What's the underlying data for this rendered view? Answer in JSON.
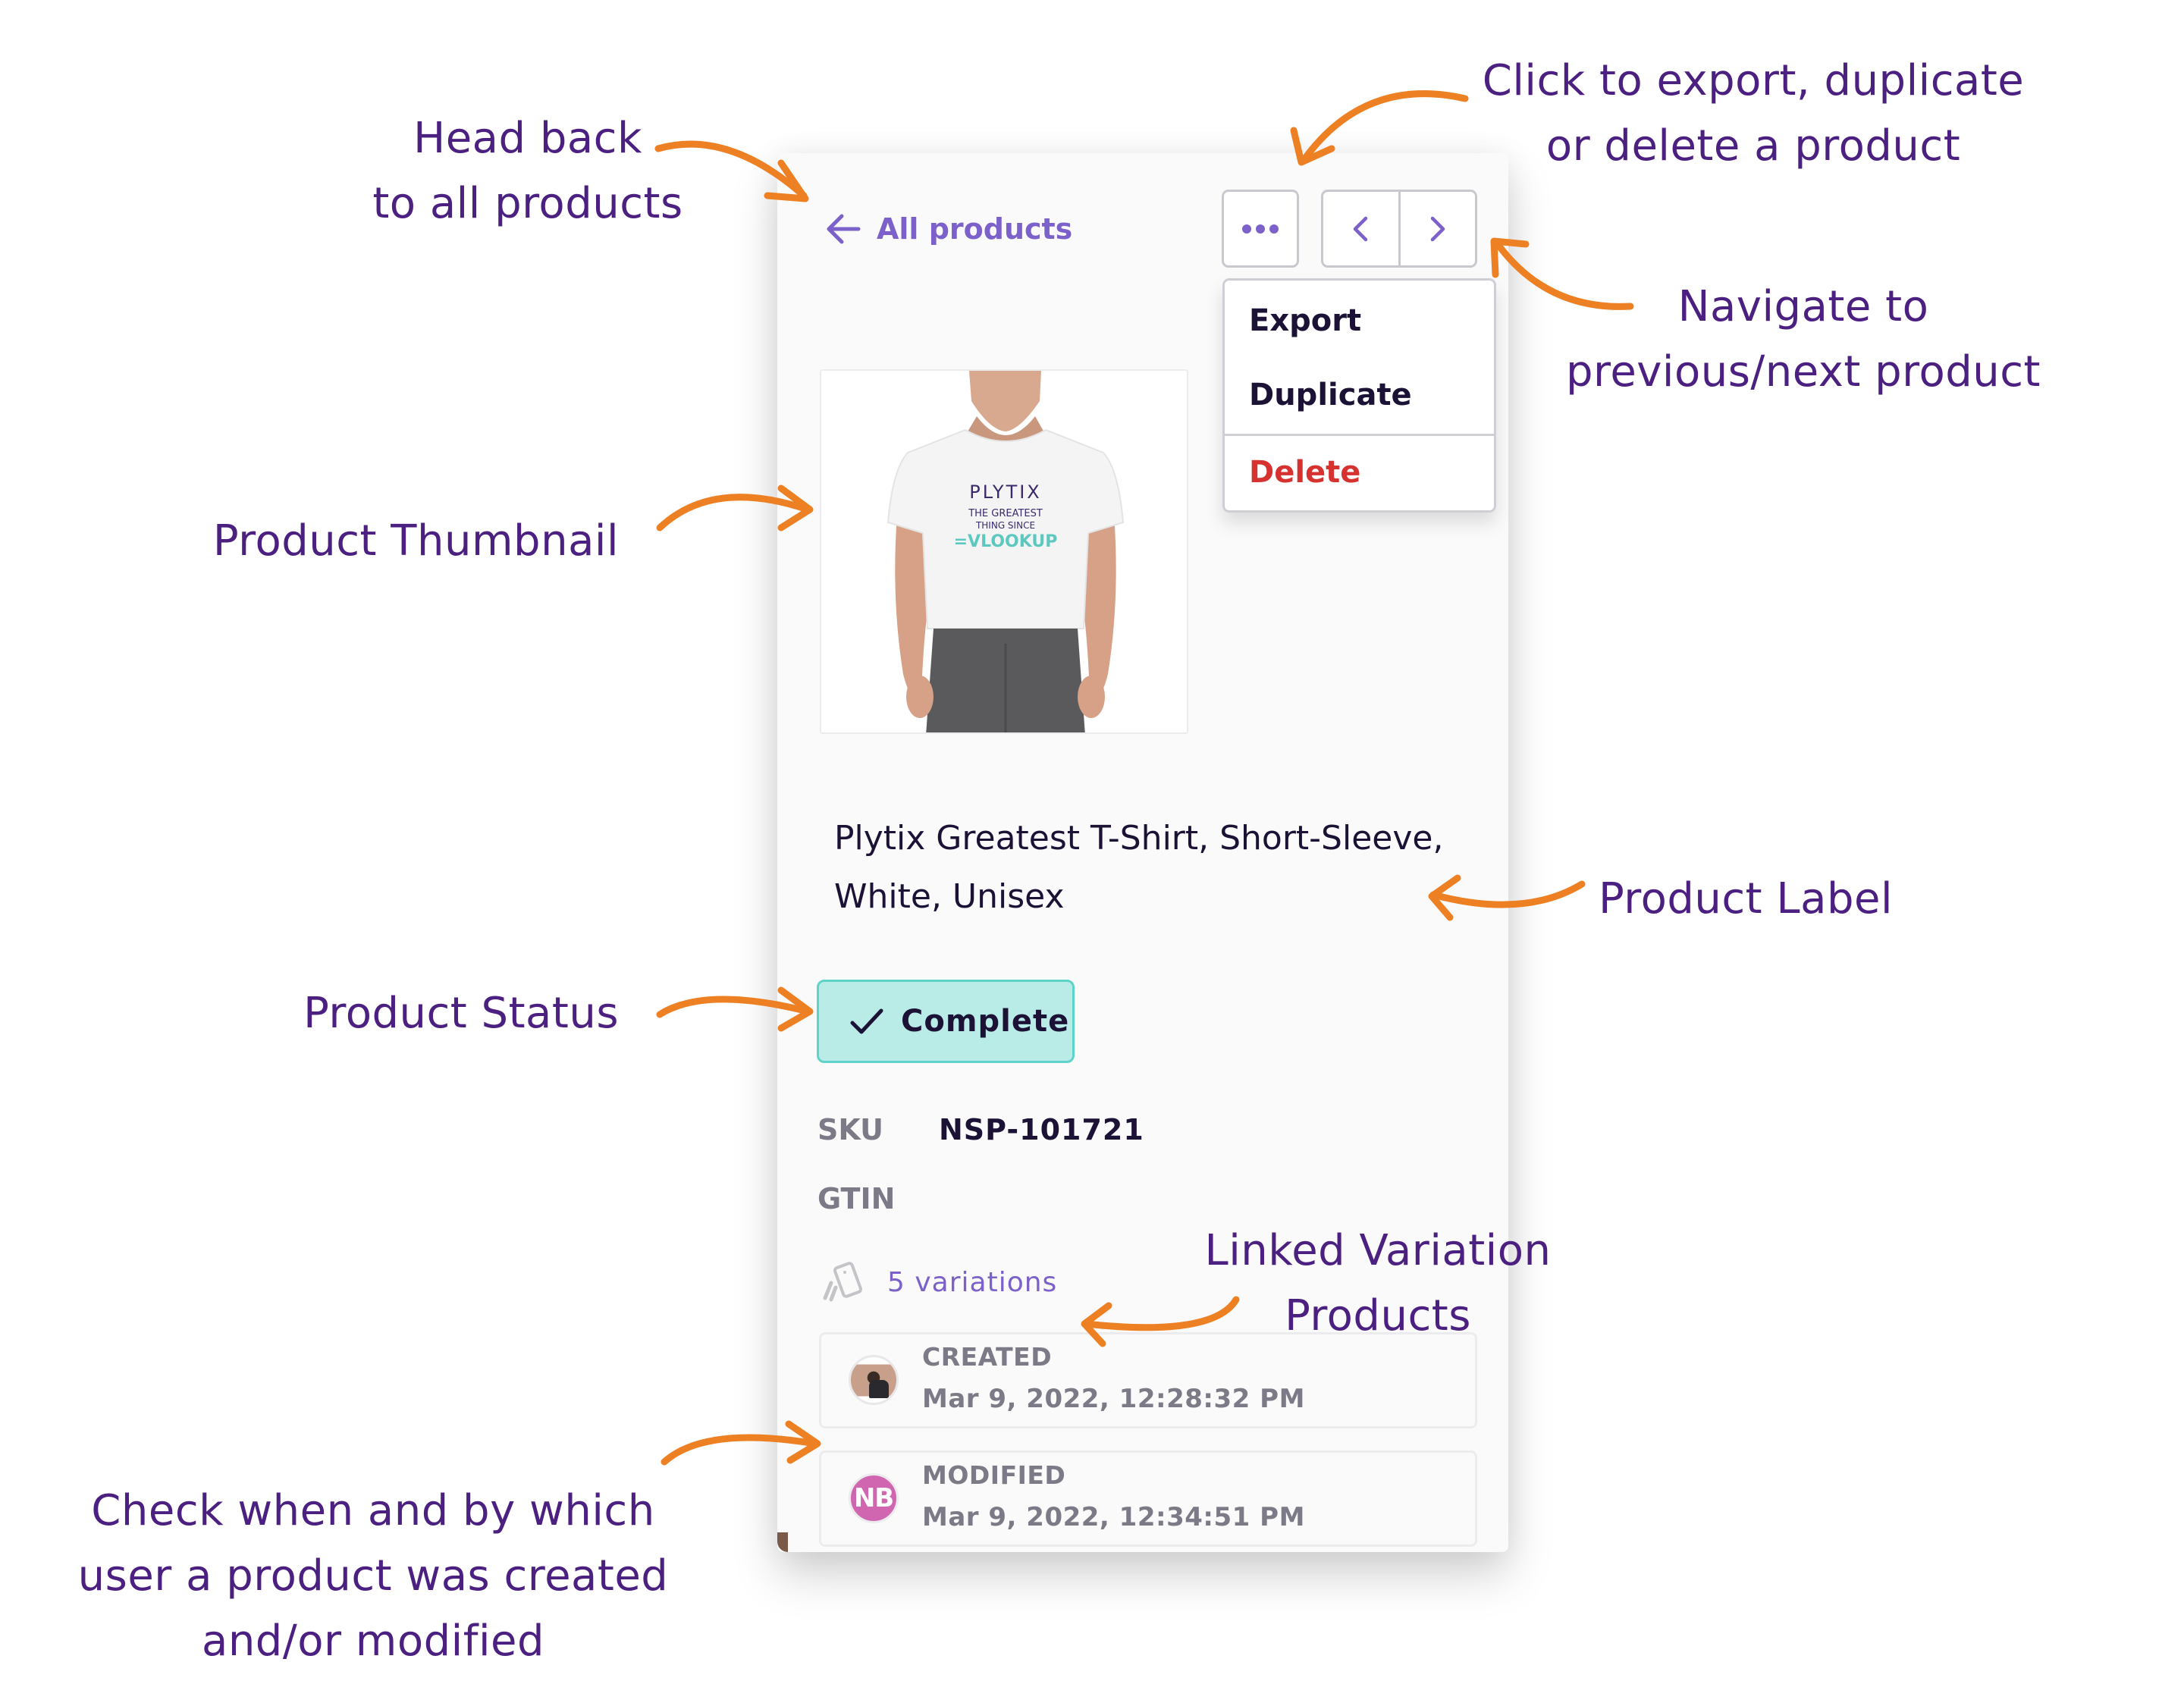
{
  "panel": {
    "back_link": "All products",
    "more_button": "more-options",
    "nav": {
      "prev_icon": "chevron-left-icon",
      "next_icon": "chevron-right-icon"
    },
    "menu": {
      "items": [
        {
          "label": "Export",
          "tone": "default"
        },
        {
          "label": "Duplicate",
          "tone": "default"
        },
        {
          "label": "Delete",
          "tone": "danger"
        }
      ]
    },
    "thumbnail": {
      "alt": "Man wearing white T-shirt",
      "shirt_lines": [
        "PLYTIX",
        "THE GREATEST",
        "THING SINCE",
        "=VLOOKUP"
      ]
    },
    "product_title": "Plytix Greatest T-Shirt, Short-Sleeve, White, Unisex",
    "status": {
      "label": "Complete",
      "icon": "checkmark-icon"
    },
    "fields": [
      {
        "label": "SKU",
        "value": "NSP-101721"
      },
      {
        "label": "GTIN",
        "value": ""
      }
    ],
    "variations": {
      "label": "5 variations",
      "icon": "variations-cards-icon"
    },
    "audit": {
      "created": {
        "label": "CREATED",
        "date": "Mar 9, 2022, 12:28:32 PM",
        "avatar": "photo"
      },
      "modified": {
        "label": "MODIFIED",
        "date": "Mar 9, 2022, 12:34:51 PM",
        "avatar_initials": "NB"
      }
    }
  },
  "annotations": {
    "head_back": [
      "Head back",
      "to all products"
    ],
    "actions_menu": [
      "Click to export, duplicate",
      "or delete a product"
    ],
    "navigate": [
      "Navigate to",
      "previous/next product"
    ],
    "thumbnail": [
      "Product Thumbnail"
    ],
    "label": [
      "Product Label"
    ],
    "status": [
      "Product Status"
    ],
    "variations": [
      "Linked Variation",
      "Products"
    ],
    "audit": [
      "Check when and by which",
      "user a product was created",
      "and/or modified"
    ]
  },
  "colors": {
    "annotation_text": "#4B2080",
    "arrow": "#EE8024",
    "link_purple": "#7B61C9",
    "status_bg": "#B9EBE7",
    "status_border": "#5FD3C9",
    "danger": "#D6322F",
    "avatar_nb": "#D066B0"
  }
}
